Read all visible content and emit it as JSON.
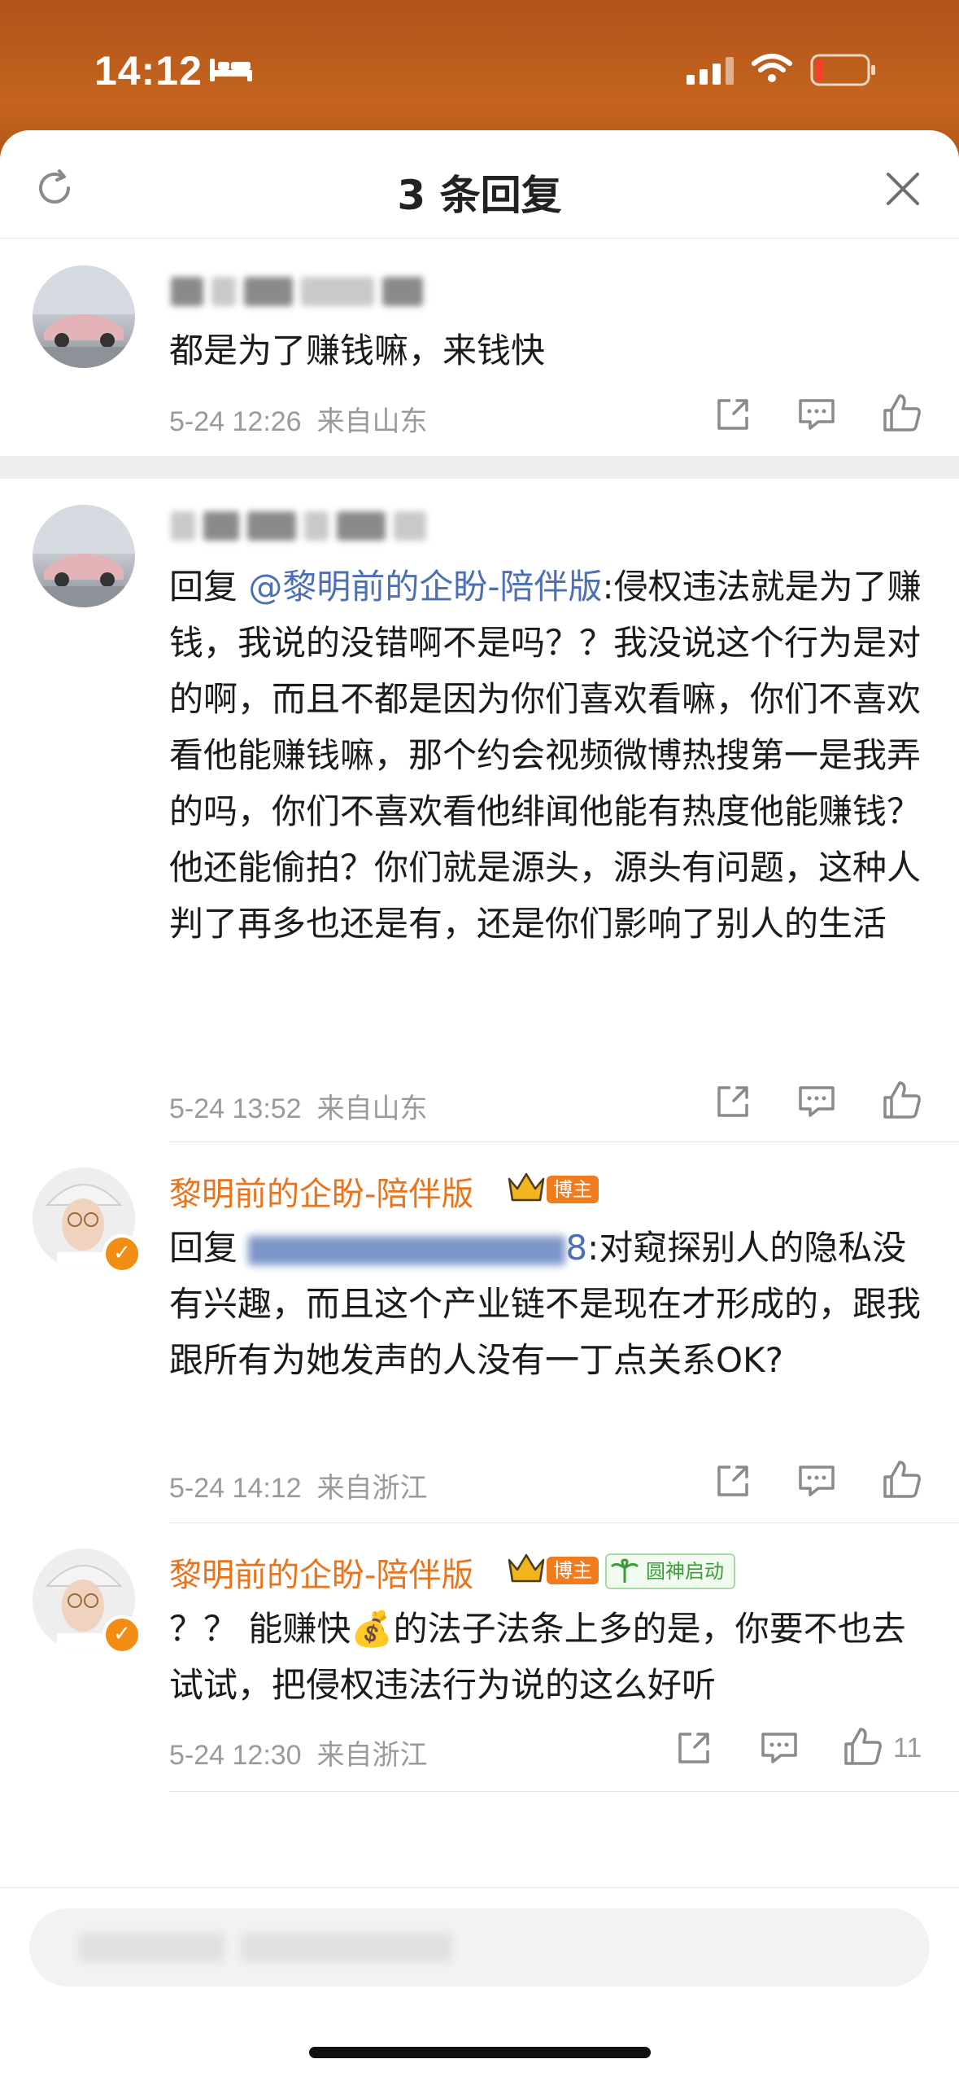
{
  "status_bar": {
    "time": "14:12"
  },
  "header": {
    "title": "3 条回复"
  },
  "comments": [
    {
      "text": "都是为了赚钱嘛，来钱快",
      "time": "5-24 12:26",
      "location": "来自山东"
    },
    {
      "reply_prefix": "回复 ",
      "mention": "@黎明前的企盼-陪伴版",
      "text": ":侵权违法就是为了赚钱，我说的没错啊不是吗？？我没说这个行为是对的啊，而且不都是因为你们喜欢看嘛，你们不喜欢看他能赚钱嘛，那个约会视频微博热搜第一是我弄的吗，你们不喜欢看他绯闻他能有热度他能赚钱？他还能偷拍？你们就是源头，源头有问题，这种人判了再多也还是有，还是你们影响了别人的生活",
      "time": "5-24 13:52",
      "location": "来自山东"
    },
    {
      "username": "黎明前的企盼-陪伴版",
      "badge": "博主",
      "reply_prefix": "回复 ",
      "mention_tail": "8",
      "text": ":对窥探别人的隐私没有兴趣，而且这个产业链不是现在才形成的，跟我跟所有为她发声的人没有一丁点关系OK?",
      "time": "5-24 14:12",
      "location": "来自浙江"
    },
    {
      "username": "黎明前的企盼-陪伴版",
      "badge": "博主",
      "game_tag": "圆神启动",
      "text_a": "？？ 能赚快",
      "emoji": "💰",
      "text_b": "的法子法条上多的是，你要不也去试试，把侵权违法行为说的这么好听",
      "time": "5-24 12:30",
      "location": "来自浙江",
      "likes": "11"
    }
  ]
}
